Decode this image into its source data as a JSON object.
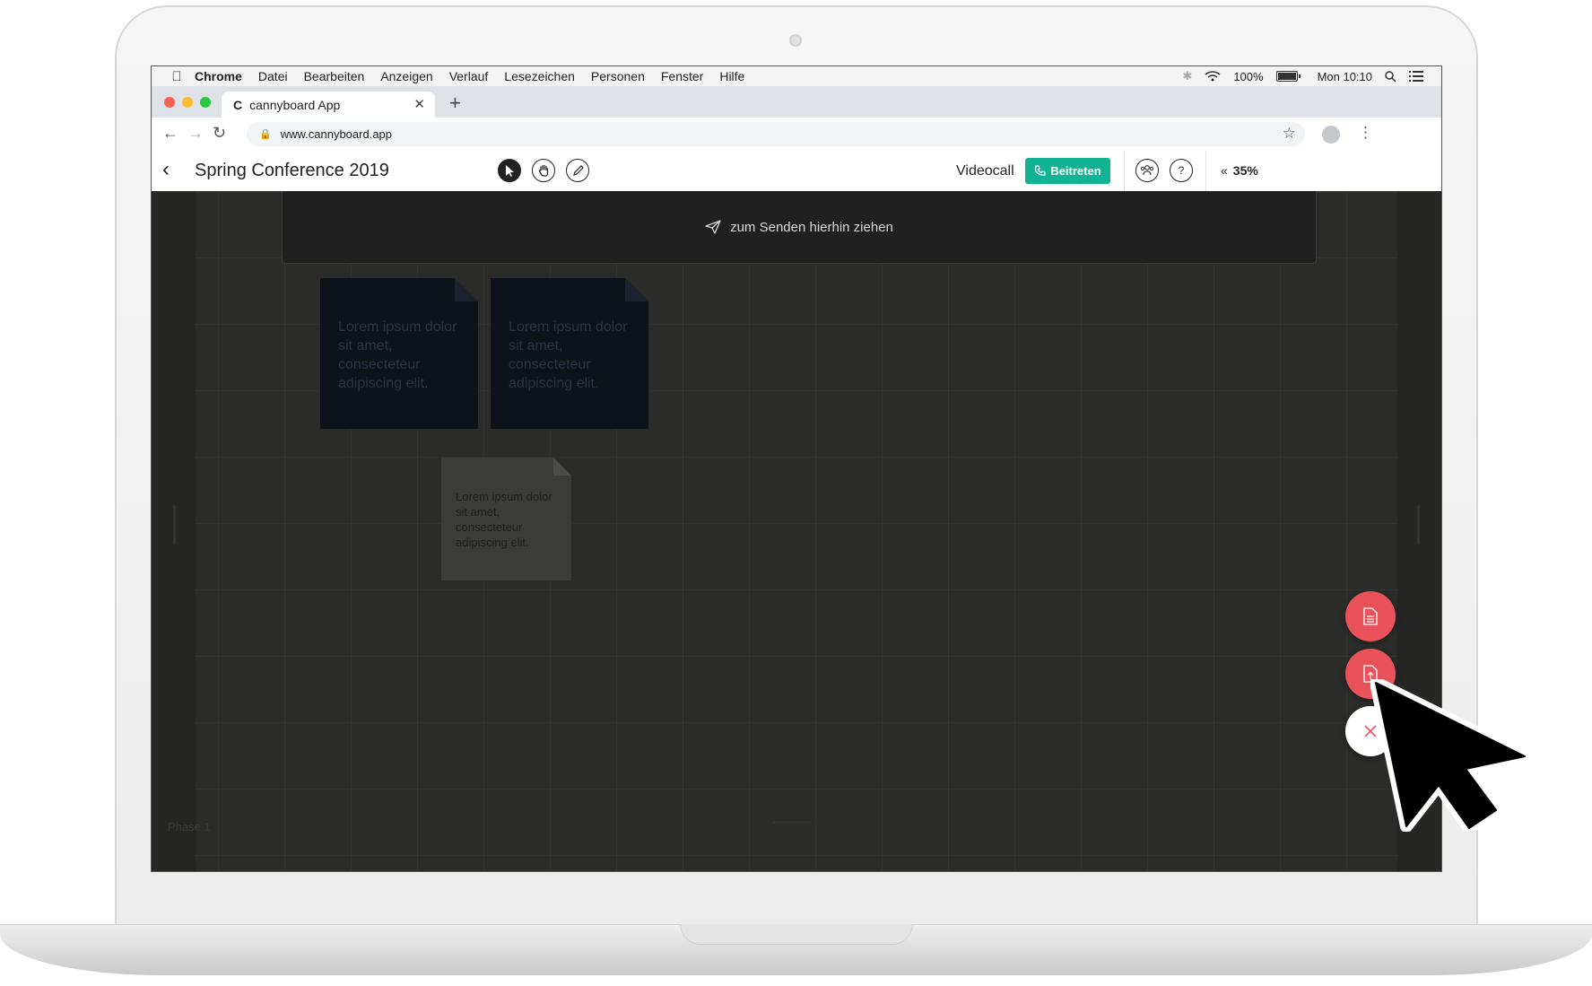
{
  "menubar": {
    "app": "Chrome",
    "items": [
      "Datei",
      "Bearbeiten",
      "Anzeigen",
      "Verlauf",
      "Lesezeichen",
      "Personen",
      "Fenster",
      "Hilfe"
    ],
    "battery": "100%",
    "clock": "Mon 10:10"
  },
  "browser": {
    "tab_title": "cannyboard App",
    "favicon": "C",
    "url": "www.cannyboard.app"
  },
  "app": {
    "board_title": "Spring Conference 2019",
    "videocall_label": "Videocall",
    "join_label": "Beitreten",
    "help_label": "?",
    "zoom": "35%"
  },
  "canvas": {
    "dropzone_text": "zum Senden hierhin ziehen",
    "sticky_notes": [
      {
        "text": "Lorem ipsum dolor sit amet, consecteteur adipiscing elit."
      },
      {
        "text": "Lorem ipsum dolor sit amet, consecteteur adipiscing elit."
      }
    ],
    "document_note": {
      "text": "Lorem ipsum dolor sit amet, consecteteur adipiscing elit."
    },
    "phase_label": "Phase 1"
  },
  "colors": {
    "accent_green": "#12b393",
    "fab_red": "#e9525a",
    "canvas_bg": "#2b2b29"
  }
}
